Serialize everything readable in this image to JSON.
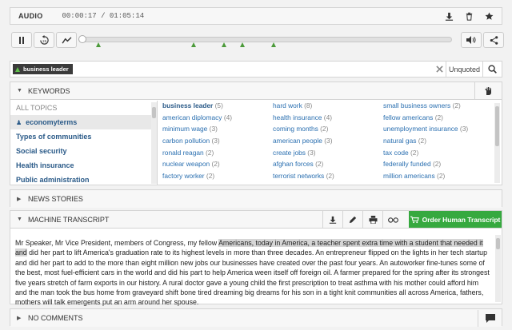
{
  "audio": {
    "label": "AUDIO",
    "time": "00:00:17 / 01:05:14"
  },
  "search": {
    "tag": "business leader",
    "unquoted_label": "Unquoted"
  },
  "keywords": {
    "header": "KEYWORDS",
    "topics": [
      {
        "label": "ALL TOPICS"
      },
      {
        "label": "economyterms",
        "active": true
      },
      {
        "label": "Types of communities"
      },
      {
        "label": "Social security"
      },
      {
        "label": "Health insurance"
      },
      {
        "label": "Public administration"
      }
    ],
    "items": [
      {
        "name": "business leader",
        "count": "(5)"
      },
      {
        "name": "hard work",
        "count": "(8)"
      },
      {
        "name": "small business owners",
        "count": "(2)"
      },
      {
        "name": "american diplomacy",
        "count": "(4)"
      },
      {
        "name": "health insurance",
        "count": "(4)"
      },
      {
        "name": "fellow americans",
        "count": "(2)"
      },
      {
        "name": "minimum wage",
        "count": "(3)"
      },
      {
        "name": "coming months",
        "count": "(2)"
      },
      {
        "name": "unemployment insurance",
        "count": "(3)"
      },
      {
        "name": "carbon pollution",
        "count": "(3)"
      },
      {
        "name": "american people",
        "count": "(3)"
      },
      {
        "name": "natural gas",
        "count": "(2)"
      },
      {
        "name": "ronald reagan",
        "count": "(2)"
      },
      {
        "name": "create jobs",
        "count": "(3)"
      },
      {
        "name": "tax code",
        "count": "(2)"
      },
      {
        "name": "nuclear weapon",
        "count": "(2)"
      },
      {
        "name": "afghan forces",
        "count": "(2)"
      },
      {
        "name": "federally funded",
        "count": "(2)"
      },
      {
        "name": "factory worker",
        "count": "(2)"
      },
      {
        "name": "terrorist networks",
        "count": "(2)"
      },
      {
        "name": "million americans",
        "count": "(2)"
      }
    ]
  },
  "news": {
    "header": "NEWS STORIES"
  },
  "transcript": {
    "header": "MACHINE TRANSCRIPT",
    "order_label": "Order Human Transcript",
    "pre": "Mr Speaker, Mr Vice President, members of Congress, my fellow ",
    "highlight": "Americans, today in America, a teacher spent extra time with a student that needed it and",
    "post": " did her part to lift America's graduation rate to its highest levels in more than three decades. An entrepreneur flipped on the lights in her tech startup and did her part to add to the more than eight million new jobs our businesses have created over the past four years. An autoworker fine-tunes some of the best, most fuel-efficient cars in the world and did his part to help America ween itself off foreign oil. A farmer prepared for the spring after its strongest five years stretch of farm exports in our history. A rural doctor gave a young child the first prescription to treat asthma with his mother could afford him and the man took the bus home from graveyard shift bone tired dreaming big dreams for his son in a tight knit communities all across America, fathers, mothers will talk emergents put an arm around her spouse."
  },
  "comments": {
    "header": "NO COMMENTS"
  }
}
